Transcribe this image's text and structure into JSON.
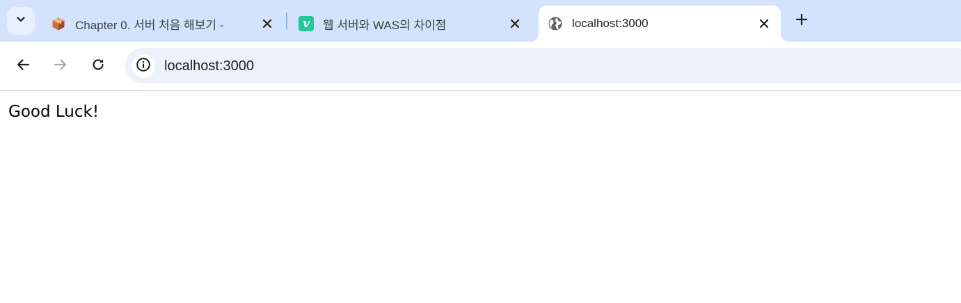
{
  "tabs": [
    {
      "title": "Chapter 0. 서버 처음 해보기 - ",
      "favicon": "package-box-icon",
      "active": false
    },
    {
      "title": "웹 서버와 WAS의 차이점",
      "favicon": "velog-v-icon",
      "favicon_letter": "v",
      "favicon_color": "#20c997",
      "active": false
    },
    {
      "title": "localhost:3000",
      "favicon": "globe-icon",
      "active": true
    }
  ],
  "toolbar": {
    "back": "back-arrow-icon",
    "forward": "forward-arrow-icon",
    "reload": "reload-icon",
    "site_info": "info-icon"
  },
  "address_bar": {
    "url": "localhost:3000"
  },
  "page": {
    "text": "Good Luck!"
  },
  "colors": {
    "tabstrip": "#d3e3fd",
    "omnibox": "#ecf1fa",
    "active_tab": "#ffffff",
    "separator": "#8ab4f8"
  }
}
